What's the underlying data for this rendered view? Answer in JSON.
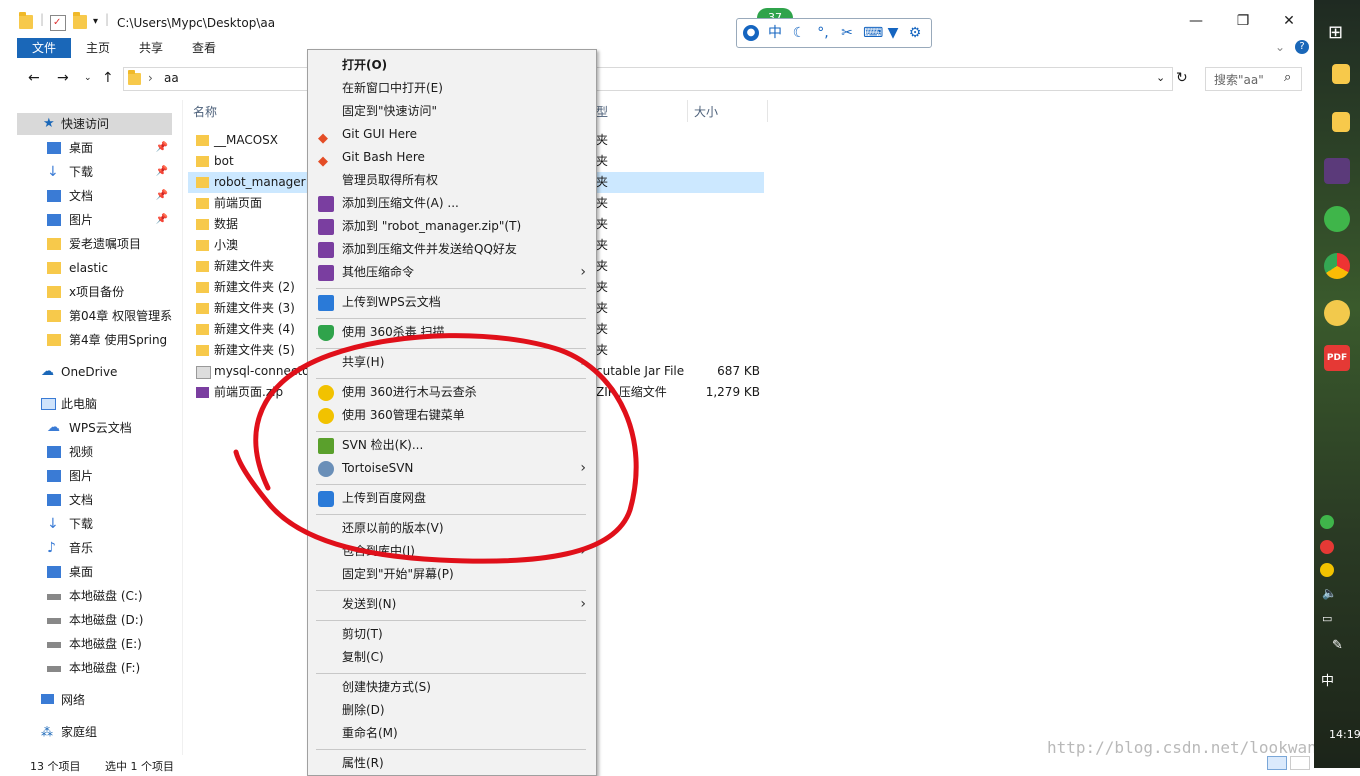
{
  "title_bar": {
    "path": "C:\\Users\\Mypc\\Desktop\\aa",
    "minimize": "—",
    "maximize": "❐",
    "close": "✕"
  },
  "ribbon": {
    "file": "文件",
    "home": "主页",
    "share": "共享",
    "view": "查看"
  },
  "address": {
    "crumb": "aa",
    "search_placeholder": "搜索\"aa\""
  },
  "nav": {
    "quick_access": "快速访问",
    "quick_items": [
      "桌面",
      "下载",
      "文档",
      "图片",
      "爱老遗嘱项目",
      "elastic",
      "x项目备份",
      "第04章 权限管理系",
      "第4章 使用Spring !"
    ],
    "onedrive": "OneDrive",
    "this_pc": "此电脑",
    "pc_items": [
      "WPS云文档",
      "视频",
      "图片",
      "文档",
      "下载",
      "音乐",
      "桌面",
      "本地磁盘 (C:)",
      "本地磁盘 (D:)",
      "本地磁盘 (E:)",
      "本地磁盘 (F:)"
    ],
    "network": "网络",
    "homegroup": "家庭组"
  },
  "columns": {
    "name": "名称",
    "type_fragment": "型",
    "size": "大小"
  },
  "files": [
    {
      "name": "__MACOSX",
      "type": "夹",
      "size": ""
    },
    {
      "name": "bot",
      "type": "夹",
      "size": ""
    },
    {
      "name": "robot_manager",
      "type": "夹",
      "size": ""
    },
    {
      "name": "前端页面",
      "type": "夹",
      "size": ""
    },
    {
      "name": "数据",
      "type": "夹",
      "size": ""
    },
    {
      "name": "小澳",
      "type": "夹",
      "size": ""
    },
    {
      "name": "新建文件夹",
      "type": "夹",
      "size": ""
    },
    {
      "name": "新建文件夹 (2)",
      "type": "夹",
      "size": ""
    },
    {
      "name": "新建文件夹 (3)",
      "type": "夹",
      "size": ""
    },
    {
      "name": "新建文件夹 (4)",
      "type": "夹",
      "size": ""
    },
    {
      "name": "新建文件夹 (5)",
      "type": "夹",
      "size": ""
    },
    {
      "name": "mysql-connecto",
      "type": "cutable Jar File",
      "size": "687 KB"
    },
    {
      "name": "前端页面.zip",
      "type": "ZIP 压缩文件",
      "size": "1,279 KB"
    }
  ],
  "menu": {
    "open": "打开(O)",
    "open_new_window": "在新窗口中打开(E)",
    "pin_quick": "固定到\"快速访问\"",
    "git_gui": "Git GUI Here",
    "git_bash": "Git Bash Here",
    "take_ownership": "管理员取得所有权",
    "add_archive": "添加到压缩文件(A) ...",
    "add_zip": "添加到 \"robot_manager.zip\"(T)",
    "add_send_qq": "添加到压缩文件并发送给QQ好友",
    "other_compress": "其他压缩命令",
    "upload_wps": "上传到WPS云文档",
    "scan_360": "使用 360杀毒 扫描",
    "share": "共享(H)",
    "trojan_360": "使用 360进行木马云查杀",
    "manage_360": "使用 360管理右键菜单",
    "svn_checkout": "SVN 检出(K)...",
    "tortoise": "TortoiseSVN",
    "baidu": "上传到百度网盘",
    "restore": "还原以前的版本(V)",
    "include_lib": "包含到库中(I)",
    "pin_start": "固定到\"开始\"屏幕(P)",
    "send_to": "发送到(N)",
    "cut": "剪切(T)",
    "copy": "复制(C)",
    "shortcut": "创建快捷方式(S)",
    "delete": "删除(D)",
    "rename": "重命名(M)",
    "properties": "属性(R)"
  },
  "status": {
    "count": "13 个项目",
    "selected": "选中 1 个项目"
  },
  "toolbar_badge": "37",
  "taskbar": {
    "ime": "中",
    "time": "14:19",
    "pdf": "PDF"
  },
  "watermark": "http://blog.csdn.net/lookwancc",
  "colors": {
    "accent": "#1a67b8",
    "selection": "#cce8ff",
    "annotation": "#e0101a"
  }
}
